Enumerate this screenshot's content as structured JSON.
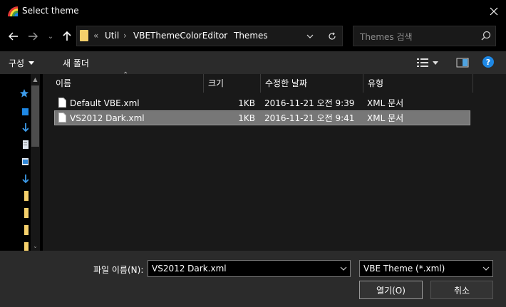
{
  "window": {
    "title": "Select theme"
  },
  "address": {
    "overflow": "«",
    "crumbs": [
      "Util",
      "VBEThemeColorEditor",
      "Themes"
    ]
  },
  "search": {
    "placeholder": "Themes 검색"
  },
  "toolbar": {
    "organize_label": "구성",
    "new_folder_label": "새 폴더"
  },
  "columns": {
    "name": "이름",
    "size": "크기",
    "modified": "수정한 날짜",
    "type": "유형"
  },
  "files": [
    {
      "name": "Default VBE.xml",
      "size": "1KB",
      "modified": "2016-11-21 오전 9:39",
      "type": "XML 문서",
      "selected": false
    },
    {
      "name": "VS2012 Dark.xml",
      "size": "1KB",
      "modified": "2016-11-21 오전 9:41",
      "type": "XML 문서",
      "selected": true
    }
  ],
  "footer": {
    "filename_label": "파일 이름(N):",
    "filename_value": "VS2012 Dark.xml",
    "filetype_value": "VBE Theme (*.xml)",
    "open_label": "열기(O)",
    "cancel_label": "취소"
  },
  "colors": {
    "accent": "#1e88e5",
    "folder": "#f5d06b",
    "background": "#191919"
  }
}
